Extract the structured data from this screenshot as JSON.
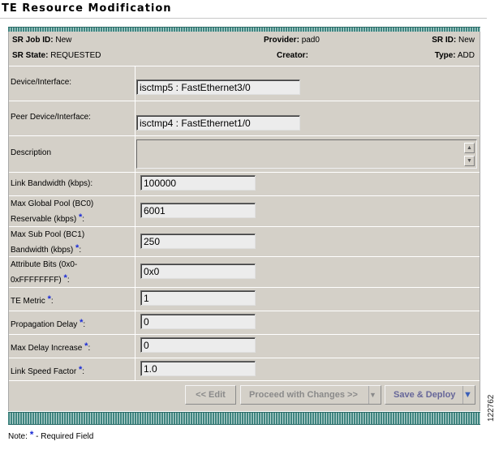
{
  "page": {
    "title": "TE Resource Modification"
  },
  "header": {
    "sr_job_id_label": "SR Job ID:",
    "sr_job_id": "New",
    "provider_label": "Provider:",
    "provider": "pad0",
    "sr_id_label": "SR ID:",
    "sr_id": "New",
    "sr_state_label": "SR State:",
    "sr_state": "REQUESTED",
    "creator_label": "Creator:",
    "creator": "",
    "type_label": "Type:",
    "type": "ADD"
  },
  "fields": {
    "device_interface": {
      "label": "Device/Interface:",
      "value": "isctmp5 : FastEthernet3/0"
    },
    "peer_device_interface": {
      "label": "Peer Device/Interface:",
      "value": "isctmp4 : FastEthernet1/0"
    },
    "description": {
      "label": "Description",
      "value": ""
    },
    "link_bandwidth": {
      "label": "Link Bandwidth (kbps):",
      "value": "100000"
    },
    "max_global_pool": {
      "label_line1": "Max Global Pool (BC0)",
      "label_line2": "Reservable (kbps)",
      "label_suffix": ":",
      "value": "6001"
    },
    "max_sub_pool": {
      "label_line1": "Max Sub Pool (BC1)",
      "label_line2": "Bandwidth (kbps)",
      "label_suffix": ":",
      "value": "250"
    },
    "attribute_bits": {
      "label_line1": "Attribute Bits (0x0-",
      "label_line2": "0xFFFFFFFF)",
      "label_suffix": ":",
      "value": "0x0"
    },
    "te_metric": {
      "label": "TE Metric",
      "label_suffix": ":",
      "value": "1"
    },
    "propagation_delay": {
      "label": "Propagation Delay",
      "label_suffix": ":",
      "value": "0"
    },
    "max_delay_increase": {
      "label": "Max Delay Increase",
      "label_suffix": ":",
      "value": "0"
    },
    "link_speed_factor": {
      "label": "Link Speed Factor",
      "label_suffix": ":",
      "value": "1.0"
    }
  },
  "required_marker": "*",
  "buttons": {
    "edit": "<< Edit",
    "proceed": "Proceed with Changes >>",
    "save_deploy": "Save & Deploy"
  },
  "footer": {
    "note_prefix": "Note:",
    "note_suffix": "- Required Field",
    "figure_id": "122762"
  },
  "colors": {
    "required": "#1a2bd6",
    "panel": "#d4d0c8",
    "band": "#3f8580"
  }
}
